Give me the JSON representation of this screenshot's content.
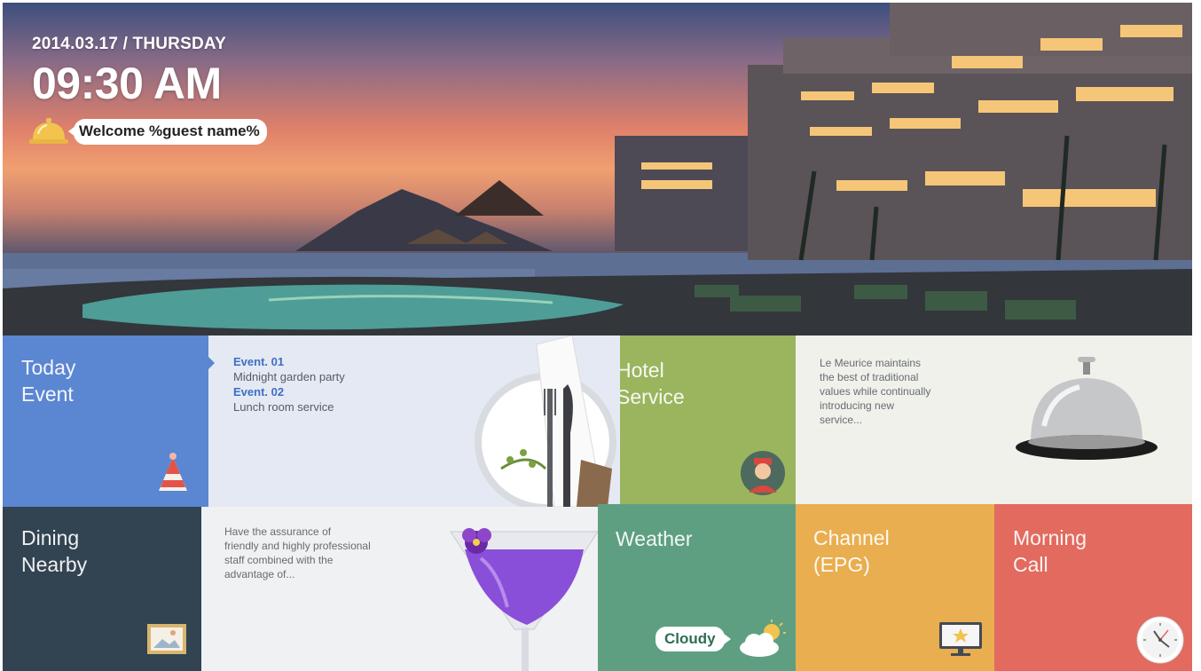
{
  "header": {
    "date": "2014.03.17 / THURSDAY",
    "time": "09:30 AM",
    "welcome": "Welcome %guest name%"
  },
  "tiles": {
    "today_event": {
      "title_line1": "Today",
      "title_line2": "Event",
      "events": [
        {
          "label": "Event. 01",
          "text": "Midnight garden party"
        },
        {
          "label": "Event. 02",
          "text": "Lunch room service"
        }
      ],
      "icon": "party-hat-icon",
      "color": "#5b86d1"
    },
    "hotel_service": {
      "title_line1": "Hotel",
      "title_line2": "Service",
      "description": [
        "Le Meurice maintains",
        "the best of traditional",
        "values while continually",
        "introducing new",
        "service..."
      ],
      "icon": "bellboy-icon",
      "color": "#9ab55e"
    },
    "dining_nearby": {
      "title_line1": "Dining",
      "title_line2": "Nearby",
      "description": [
        "Have the assurance of",
        "friendly and highly professional",
        "staff combined with the",
        "advantage of..."
      ],
      "icon": "picture-frame-icon",
      "color": "#324351"
    },
    "weather": {
      "title": "Weather",
      "condition": "Cloudy",
      "icon": "cloud-sun-icon",
      "color": "#5e9f82"
    },
    "channel": {
      "title_line1": "Channel",
      "title_line2": "(EPG)",
      "icon": "tv-star-icon",
      "color": "#e9ae4f"
    },
    "morning_call": {
      "title_line1": "Morning",
      "title_line2": "Call",
      "icon": "clock-icon",
      "color": "#e26a5e"
    }
  }
}
